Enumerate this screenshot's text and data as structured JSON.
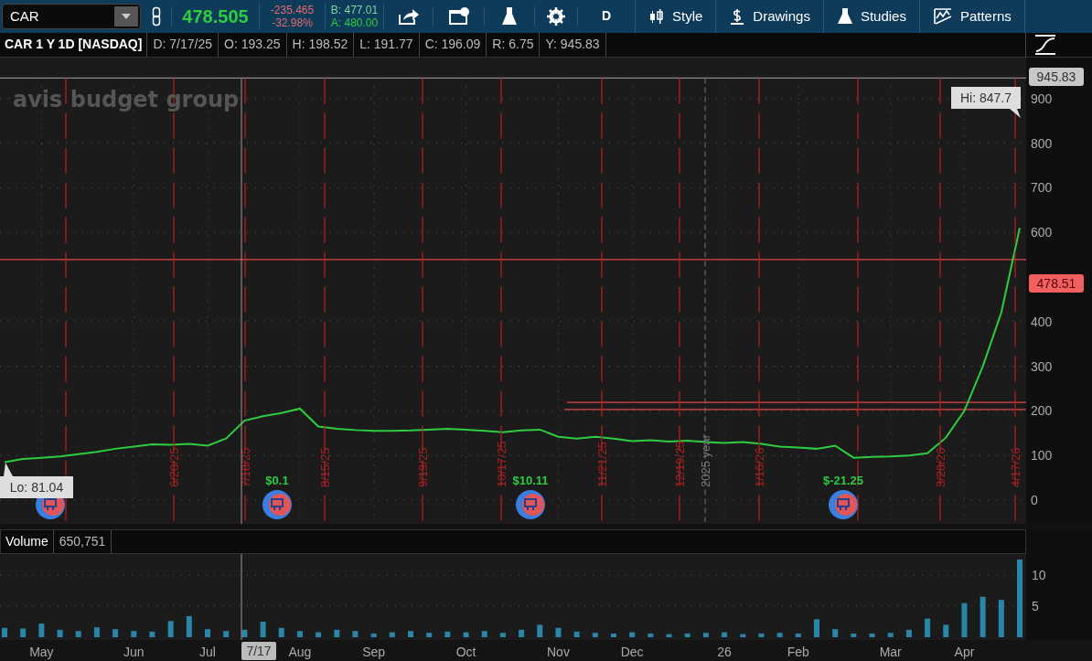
{
  "toolbar": {
    "last": "478.505",
    "change": "-235.465",
    "change_pct": "-32.98%",
    "bid": "B: 477.01",
    "ask": "A: 480.00",
    "aggregation": "D",
    "menus": [
      {
        "label": "Style",
        "kind": "style"
      },
      {
        "label": "Drawings",
        "kind": "drawings"
      },
      {
        "label": "Studies",
        "kind": "studies"
      },
      {
        "label": "Patterns",
        "kind": "patterns"
      }
    ]
  },
  "header": {
    "title": "CAR 1 Y 1D [NASDAQ]",
    "fields": [
      "D: 7/17/25",
      "O: 193.25",
      "H: 198.52",
      "L: 191.77",
      "C: 196.09",
      "R: 6.75",
      "Y: 945.83"
    ]
  },
  "logo": "avis budget group",
  "price_chart": {
    "chart_data": {
      "type": "line",
      "grid": true,
      "ylim": [
        -53.3,
        991.8
      ],
      "yticks": [
        0,
        100,
        200,
        300,
        400,
        600,
        700,
        800,
        900
      ],
      "series": [
        {
          "name": "CAR",
          "color": "#2ecc40",
          "values": [
            85,
            92,
            95,
            98,
            103,
            108,
            115,
            120,
            125,
            124,
            126,
            122,
            138,
            178,
            188,
            195,
            205,
            165,
            160,
            157,
            155,
            155,
            156,
            158,
            160,
            158,
            155,
            152,
            156,
            158,
            142,
            138,
            142,
            138,
            132,
            134,
            131,
            133,
            130,
            128,
            130,
            126,
            120,
            118,
            115,
            122,
            95,
            97,
            98,
            100,
            105,
            140,
            200,
            300,
            420,
            610
          ]
        }
      ],
      "ref_lines": [
        {
          "axis": "y",
          "value": 945.83,
          "color": "#888888"
        },
        {
          "axis": "y",
          "value": 539,
          "color": "#e04848"
        },
        {
          "axis": "y",
          "value": 219,
          "color": "#e04848"
        },
        {
          "axis": "y",
          "value": 203,
          "color": "#e04848"
        }
      ]
    }
  },
  "events": [
    {
      "label": "6/20/25"
    },
    {
      "label": "7/18/25"
    },
    {
      "label": "8/15/25"
    },
    {
      "label": "9/19/25"
    },
    {
      "label": "10/17/25"
    },
    {
      "label": "11/21/25"
    },
    {
      "label": "12/19/25"
    },
    {
      "label": "1/16/26"
    },
    {
      "label": "3/20/26"
    },
    {
      "label": "4/17/26"
    }
  ],
  "year_label": "2025 year",
  "earnings": [
    {
      "dividend": false
    },
    {
      "dividend": true,
      "label": "$0.1"
    },
    {
      "dividend": true,
      "label": "$10.11"
    },
    {
      "dividend": true,
      "label": "$-21.25"
    }
  ],
  "high_label": "Hi: 847.7",
  "low_label": "Lo: 81.04",
  "price_tags": [
    {
      "label": "945.83",
      "color": "#c8c8c8"
    },
    {
      "label": "478.51",
      "color": "#f06060"
    }
  ],
  "volume": {
    "value": "650,751",
    "chart_data": {
      "type": "bar",
      "ylim": [
        -0.44,
        13.38
      ],
      "yticks": [
        5,
        10
      ],
      "categories": [
        null,
        null,
        "May",
        null,
        null,
        null,
        null,
        "Jun",
        null,
        null,
        null,
        "Jul",
        null,
        null,
        null,
        null,
        "Aug",
        null,
        null,
        null,
        "Sep",
        null,
        null,
        null,
        null,
        "Oct",
        null,
        null,
        null,
        null,
        "Nov",
        null,
        null,
        null,
        "Dec",
        null,
        null,
        null,
        null,
        "26",
        null,
        null,
        null,
        "Feb",
        null,
        null,
        null,
        null,
        "Mar",
        null,
        null,
        null,
        "Apr",
        null,
        null,
        null
      ],
      "series": [
        {
          "name": "Volume",
          "color": "#2a86a8",
          "values": [
            1.5,
            1.4,
            2.2,
            1.2,
            1.0,
            1.6,
            1.3,
            1.0,
            0.9,
            2.6,
            3.4,
            1.3,
            1.0,
            1.2,
            2.5,
            1.5,
            1.0,
            0.8,
            1.2,
            1.0,
            0.6,
            0.8,
            1.0,
            0.7,
            0.9,
            0.8,
            1.0,
            0.7,
            1.2,
            2.0,
            1.5,
            0.9,
            0.7,
            0.6,
            0.8,
            0.6,
            0.5,
            0.6,
            0.7,
            0.8,
            0.5,
            0.6,
            0.7,
            0.6,
            2.9,
            1.3,
            0.6,
            0.6,
            0.7,
            1.2,
            3.0,
            2.0,
            5.5,
            6.5,
            6.0,
            12.5
          ]
        }
      ]
    }
  },
  "crosshair_label": "7/17"
}
